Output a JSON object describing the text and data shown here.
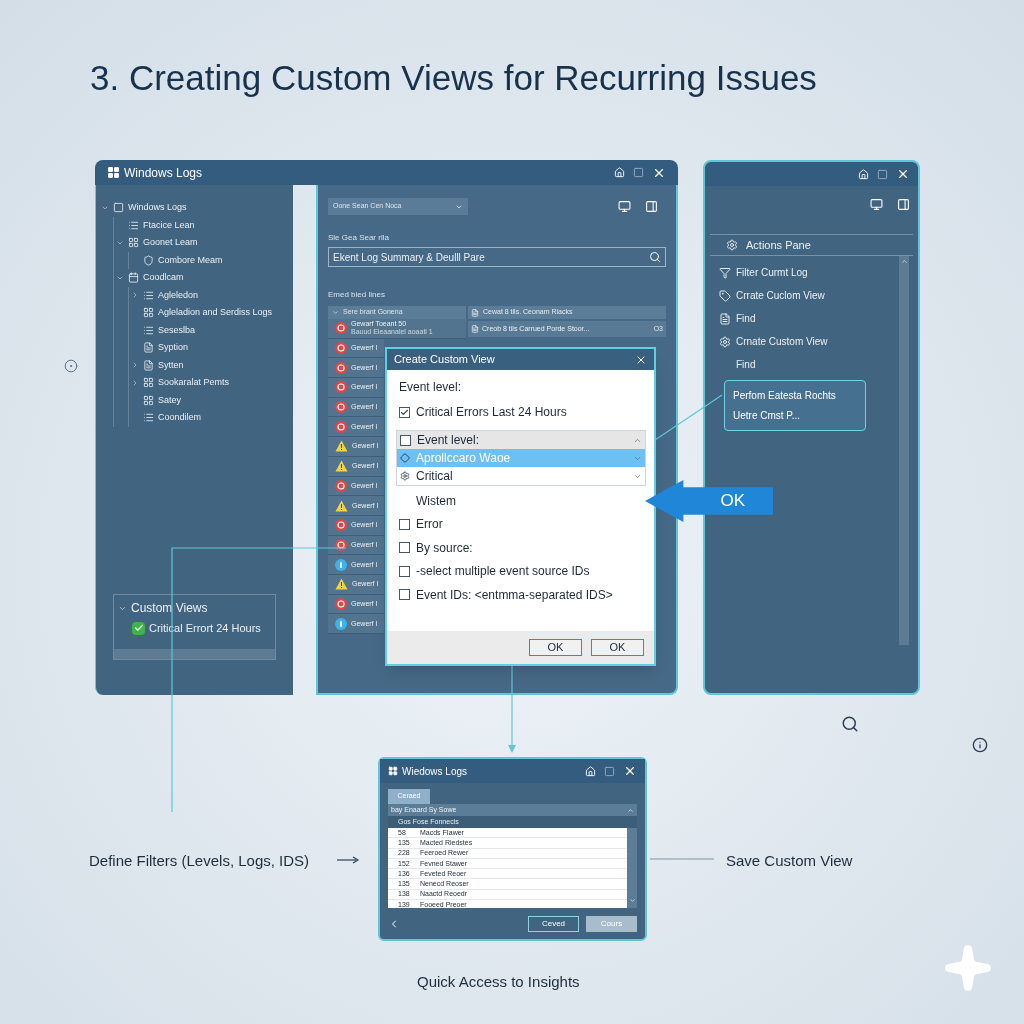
{
  "title": "3. Creating Custom Views for Recurring Issues",
  "main_window": {
    "title": "Windows Logs",
    "tree": [
      {
        "label": "Windows Logs",
        "expanded": true,
        "children": [
          {
            "label": "Ftacice Lean"
          },
          {
            "label": "Goonet Leam",
            "expanded": true,
            "children": [
              {
                "label": "Combore Meam"
              }
            ]
          },
          {
            "label": "Coodlcam",
            "expanded": true,
            "children": [
              {
                "label": "Agleledon",
                "expanded": false
              },
              {
                "label": "Agleladion and Serdiss Logs"
              },
              {
                "label": "Seseslba"
              },
              {
                "label": "Syption"
              },
              {
                "label": "Sytten",
                "expanded": false
              },
              {
                "label": "Sookaralat Pemts",
                "expanded": false
              },
              {
                "label": "Satey"
              },
              {
                "label": "Coondilem"
              }
            ]
          }
        ]
      }
    ],
    "custom_views": {
      "label": "Custom Views",
      "expanded": true,
      "items": [
        {
          "label": "Critical Errort 24 Hours",
          "checked": true
        }
      ]
    },
    "dropdown": {
      "value": "Oone Sean Cen Noca"
    },
    "search_label": "Sle Gea Sear rlla",
    "search": {
      "value": "Ekent Log Summary & Deulll Pare"
    },
    "list_label": "Emed bied lines",
    "list_header": "Sere brant Gonena",
    "events": [
      {
        "kind": "error",
        "title": "Gewarf Toeant 50",
        "subtitle": "Bauud Eleaanalel aoaati 1"
      },
      {
        "kind": "error",
        "title": "Gewerf I"
      },
      {
        "kind": "error",
        "title": "Gewerf I"
      },
      {
        "kind": "error",
        "title": "Gewerf I"
      },
      {
        "kind": "error",
        "title": "Gewerf I"
      },
      {
        "kind": "error",
        "title": "Gewerf I"
      },
      {
        "kind": "warning",
        "title": "Gewerf I"
      },
      {
        "kind": "warning",
        "title": "Gewerf I"
      },
      {
        "kind": "error",
        "title": "Gewerf I"
      },
      {
        "kind": "warning",
        "title": "Gewerf I"
      },
      {
        "kind": "error",
        "title": "Gewerf I"
      },
      {
        "kind": "error",
        "title": "Gewerf I"
      },
      {
        "kind": "info",
        "title": "Gewerf I"
      },
      {
        "kind": "warning",
        "title": "Gewerf I"
      },
      {
        "kind": "error",
        "title": "Gewerf I"
      },
      {
        "kind": "info",
        "title": "Gewerf I"
      }
    ],
    "detail_header": "Cewat 8 tils. Ceonam Riacks",
    "detail_rows": [
      {
        "label": "Creob 8 tils Carrued Porde Stoor...",
        "value": "O3"
      }
    ]
  },
  "dialog": {
    "title": "Create Custom View",
    "level_label": "Event level:",
    "preset": {
      "label": "Critical Errors Last 24 Hours",
      "checked": true
    },
    "listbox": [
      {
        "kind": "checkbox",
        "label": "Event level:",
        "checked": false,
        "selected": false
      },
      {
        "kind": "diamond",
        "label": "Aprollccaro Waoe",
        "selected": true
      },
      {
        "kind": "gear",
        "label": "Critical",
        "selected": false
      }
    ],
    "options": [
      {
        "kind": "plain",
        "label": "Wistem"
      },
      {
        "kind": "checkbox",
        "label": "Error",
        "checked": false
      },
      {
        "kind": "checkbox",
        "label": "By source:",
        "checked": false
      },
      {
        "kind": "checkbox",
        "label": "-select multiple event source IDs",
        "checked": false
      },
      {
        "kind": "checkbox",
        "label": "Event IDs: <entmma-separated IDS>",
        "checked": false
      }
    ],
    "buttons": [
      "OK",
      "OK"
    ]
  },
  "callout": {
    "label": "OK"
  },
  "actions_window": {
    "header": "Actions Pane",
    "items": [
      "Filter Curmt Log",
      "Crrate Cuclom View",
      "Find",
      "Crnate Custom View",
      "Find"
    ],
    "tooltip": [
      "Perfom Eatesta Rochts",
      "Uetre Cmst P..."
    ]
  },
  "bottom_window": {
    "title": "Wiedows Logs",
    "tab": "Ceraed",
    "group_header": "bay Enaard Sy Sowe",
    "column_header": "Gos Fose Fonnecis",
    "rows": [
      {
        "id": "58",
        "name": "Macds FIawer"
      },
      {
        "id": "135",
        "name": "Macted Riedstes"
      },
      {
        "id": "228",
        "name": "Feeroed Rewer"
      },
      {
        "id": "152",
        "name": "Fevned Stawer"
      },
      {
        "id": "136",
        "name": "Feveted Reoer"
      },
      {
        "id": "135",
        "name": "Nenecd Reoser"
      },
      {
        "id": "138",
        "name": "Naactd Reoedr"
      },
      {
        "id": "139",
        "name": "Fooeed Preoer"
      }
    ],
    "buttons": [
      {
        "label": "Ceved",
        "disabled": false
      },
      {
        "label": "Cours",
        "disabled": true
      }
    ]
  },
  "captions": {
    "left": "Define Filters (Levels, Logs, IDS)",
    "right": "Save Custom View",
    "bottom": "Quick Access to Insights"
  }
}
